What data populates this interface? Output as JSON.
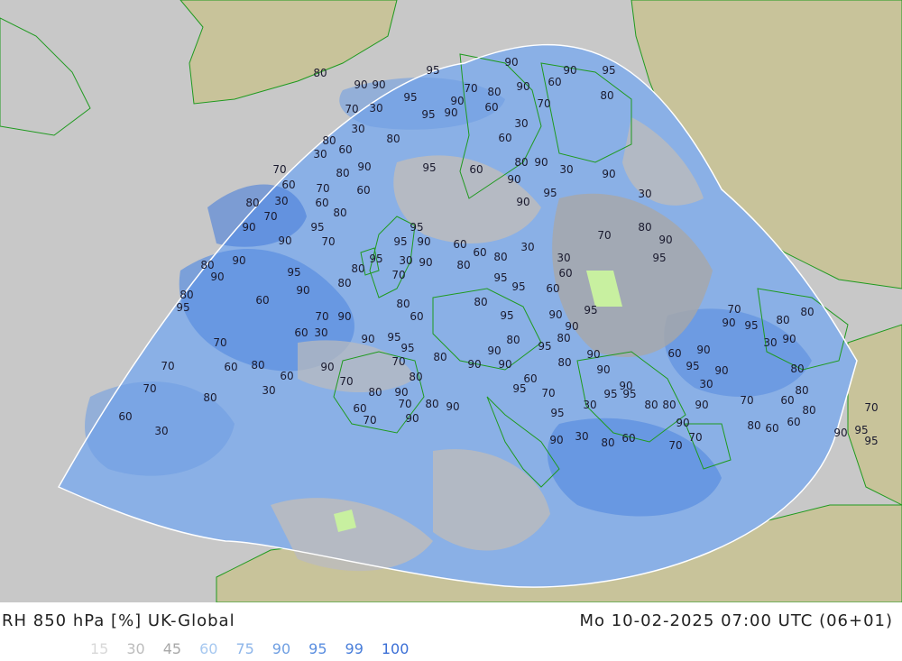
{
  "header": {
    "title": "RH 850 hPa [%] UK-Global",
    "datetime": "Mo 10-02-2025 07:00 UTC (06+01)"
  },
  "legend": {
    "items": [
      {
        "label": "15",
        "color": "#d8d8d8"
      },
      {
        "label": "30",
        "color": "#bcbcbc"
      },
      {
        "label": "45",
        "color": "#a8a8a8"
      },
      {
        "label": "60",
        "color": "#a6c8f0"
      },
      {
        "label": "75",
        "color": "#8eb6ea"
      },
      {
        "label": "90",
        "color": "#6f9fe2"
      },
      {
        "label": "95",
        "color": "#5a8ee0"
      },
      {
        "label": "99",
        "color": "#4a7fda"
      },
      {
        "label": "100",
        "color": "#3b6fd6"
      }
    ]
  },
  "colors": {
    "land": "#c8c39a",
    "sea_outside": "#c8c8c8",
    "coastline": "#1f9a1f",
    "field_base": "#8ab0e6"
  },
  "contour_labels": [
    "80",
    "95",
    "90",
    "90",
    "95",
    "90",
    "90",
    "95",
    "70",
    "80",
    "90",
    "60",
    "80",
    "70",
    "30",
    "95",
    "90",
    "90",
    "60",
    "70",
    "30",
    "80",
    "30",
    "60",
    "80",
    "60",
    "30",
    "90",
    "95",
    "60",
    "80",
    "90",
    "30",
    "90",
    "70",
    "80",
    "60",
    "70",
    "60",
    "90",
    "95",
    "90",
    "30",
    "80",
    "30",
    "60",
    "70",
    "80",
    "90",
    "95",
    "95",
    "80",
    "90",
    "70",
    "95",
    "90",
    "60",
    "30",
    "70",
    "90",
    "60",
    "80",
    "30",
    "95",
    "80",
    "90",
    "95",
    "30",
    "90",
    "80",
    "80",
    "90",
    "95",
    "70",
    "60",
    "80",
    "90",
    "95",
    "95",
    "60",
    "80",
    "95",
    "60",
    "80",
    "80",
    "95",
    "60",
    "70",
    "90",
    "95",
    "90",
    "70",
    "60",
    "30",
    "90",
    "95",
    "80",
    "90",
    "80",
    "95",
    "90",
    "95",
    "80",
    "80",
    "70",
    "95",
    "90",
    "90",
    "60",
    "90",
    "30",
    "90",
    "70",
    "60",
    "80",
    "90",
    "70",
    "80",
    "90",
    "90",
    "80",
    "90",
    "95",
    "90",
    "80",
    "70",
    "60",
    "30",
    "70",
    "80",
    "60",
    "90",
    "95",
    "80",
    "80",
    "90",
    "95",
    "70",
    "95",
    "30",
    "70",
    "60",
    "80",
    "60",
    "60",
    "70",
    "80",
    "90",
    "30",
    "80",
    "80",
    "90",
    "70",
    "90",
    "95",
    "90",
    "80",
    "70",
    "30",
    "90",
    "30",
    "80",
    "60",
    "70",
    "70",
    "80",
    "60",
    "60",
    "90",
    "95",
    "95",
    "90",
    "80",
    "80",
    "70",
    "80",
    "90",
    "70",
    "80",
    "70",
    "95",
    "90"
  ]
}
